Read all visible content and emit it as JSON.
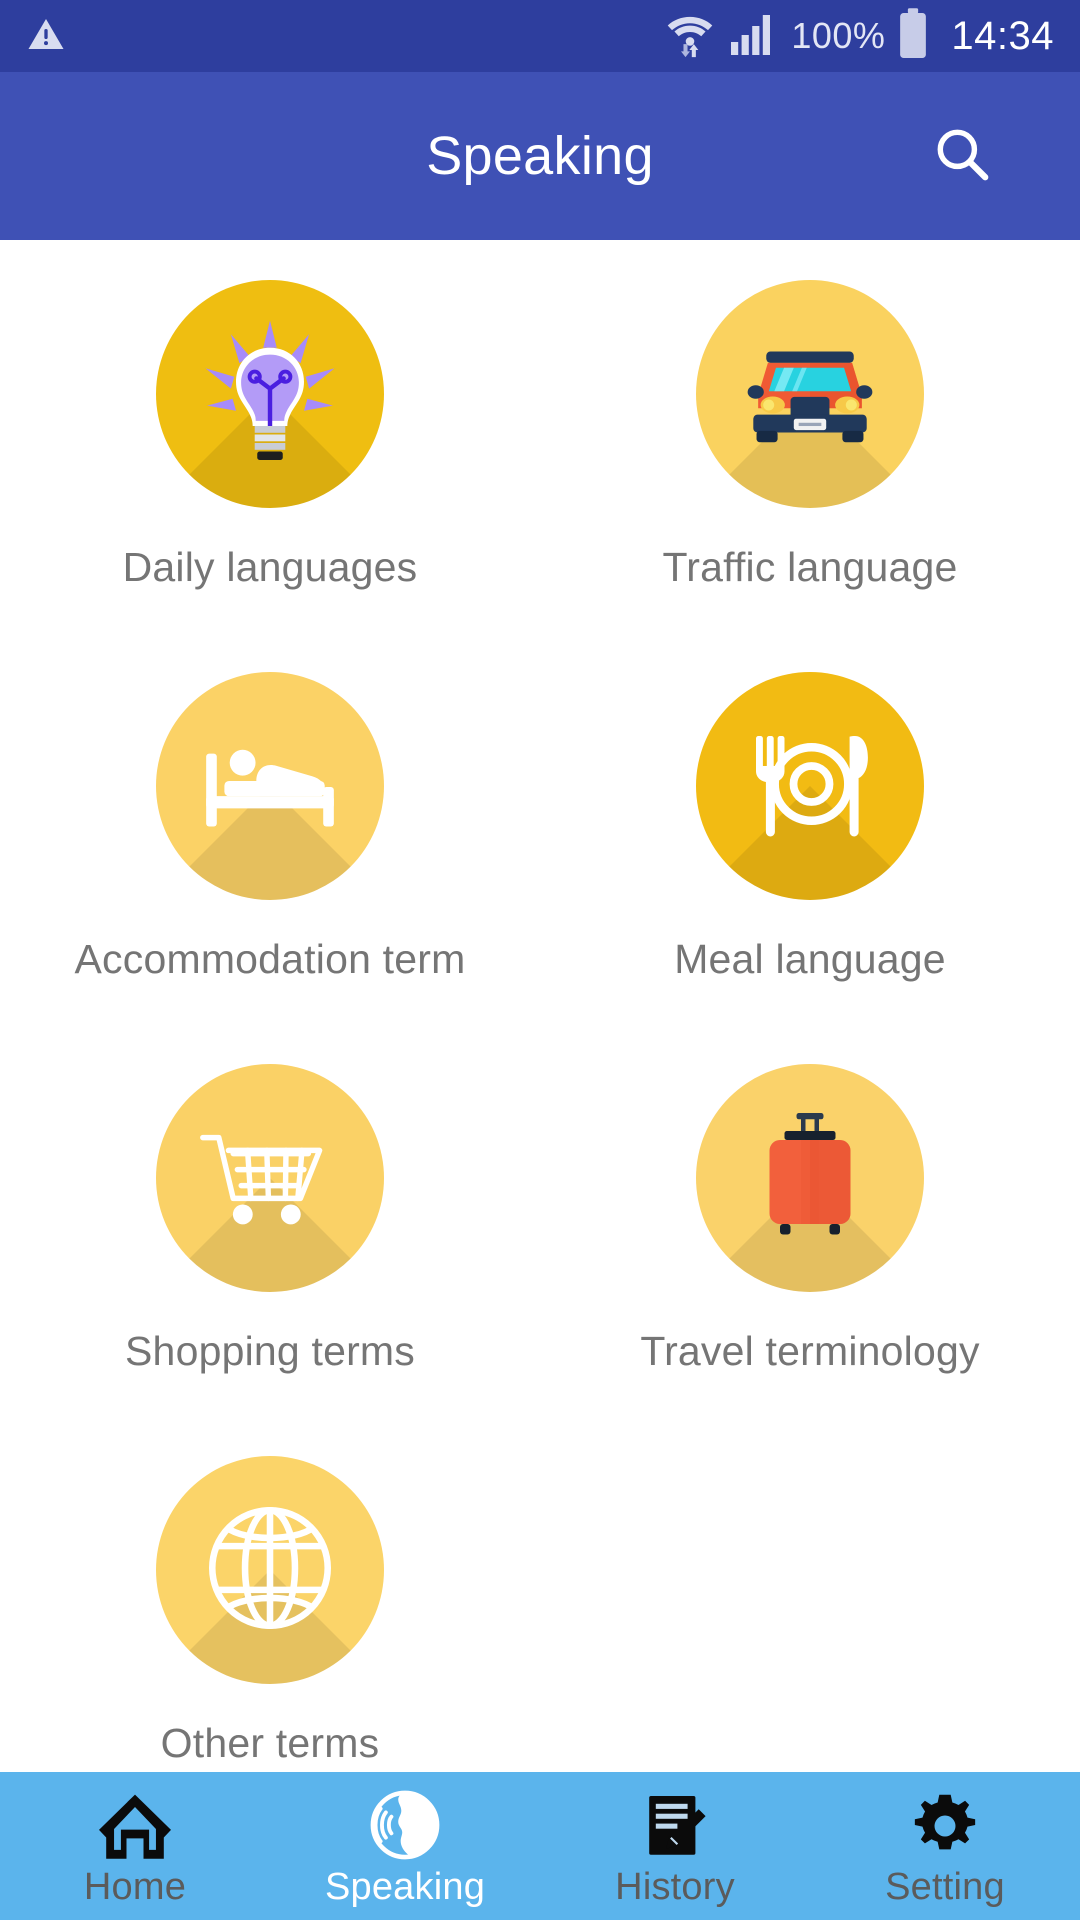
{
  "status_bar": {
    "warning_icon": "warning-triangle-icon",
    "wifi_icon": "wifi-icon",
    "signal_icon": "cellular-signal-icon",
    "battery_percent": "100%",
    "battery_icon": "battery-full-icon",
    "clock": "14:34",
    "background_color": "#2E3E9E",
    "text_color": "#D8DCF0"
  },
  "app_bar": {
    "title": "Speaking",
    "search_icon": "search-icon",
    "background_color": "#3F51B5",
    "title_color": "#FFFFFF"
  },
  "grid": {
    "items": [
      {
        "label": "Daily languages",
        "icon": "lightbulb-icon",
        "circle_color": "#EFBE11"
      },
      {
        "label": "Traffic language",
        "icon": "car-front-icon",
        "circle_color": "#FAD25F"
      },
      {
        "label": "Accommodation term",
        "icon": "bed-icon",
        "circle_color": "#FBD266"
      },
      {
        "label": "Meal language",
        "icon": "cutlery-plate-icon",
        "circle_color": "#F2BB13"
      },
      {
        "label": "Shopping terms",
        "icon": "shopping-cart-icon",
        "circle_color": "#FAD166"
      },
      {
        "label": "Travel terminology",
        "icon": "suitcase-icon",
        "circle_color": "#FAD26A"
      },
      {
        "label": "Other terms",
        "icon": "globe-icon",
        "circle_color": "#FBD469"
      }
    ],
    "label_color": "#757575"
  },
  "bottom_nav": {
    "background_color": "#5BB4EC",
    "active_color": "#FFFFFF",
    "inactive_color": "#5B5B5B",
    "items": [
      {
        "label": "Home",
        "icon": "home-icon",
        "active": false
      },
      {
        "label": "Speaking",
        "icon": "speaking-head-icon",
        "active": true
      },
      {
        "label": "History",
        "icon": "document-pencil-icon",
        "active": false
      },
      {
        "label": "Setting",
        "icon": "gear-icon",
        "active": false
      }
    ]
  }
}
